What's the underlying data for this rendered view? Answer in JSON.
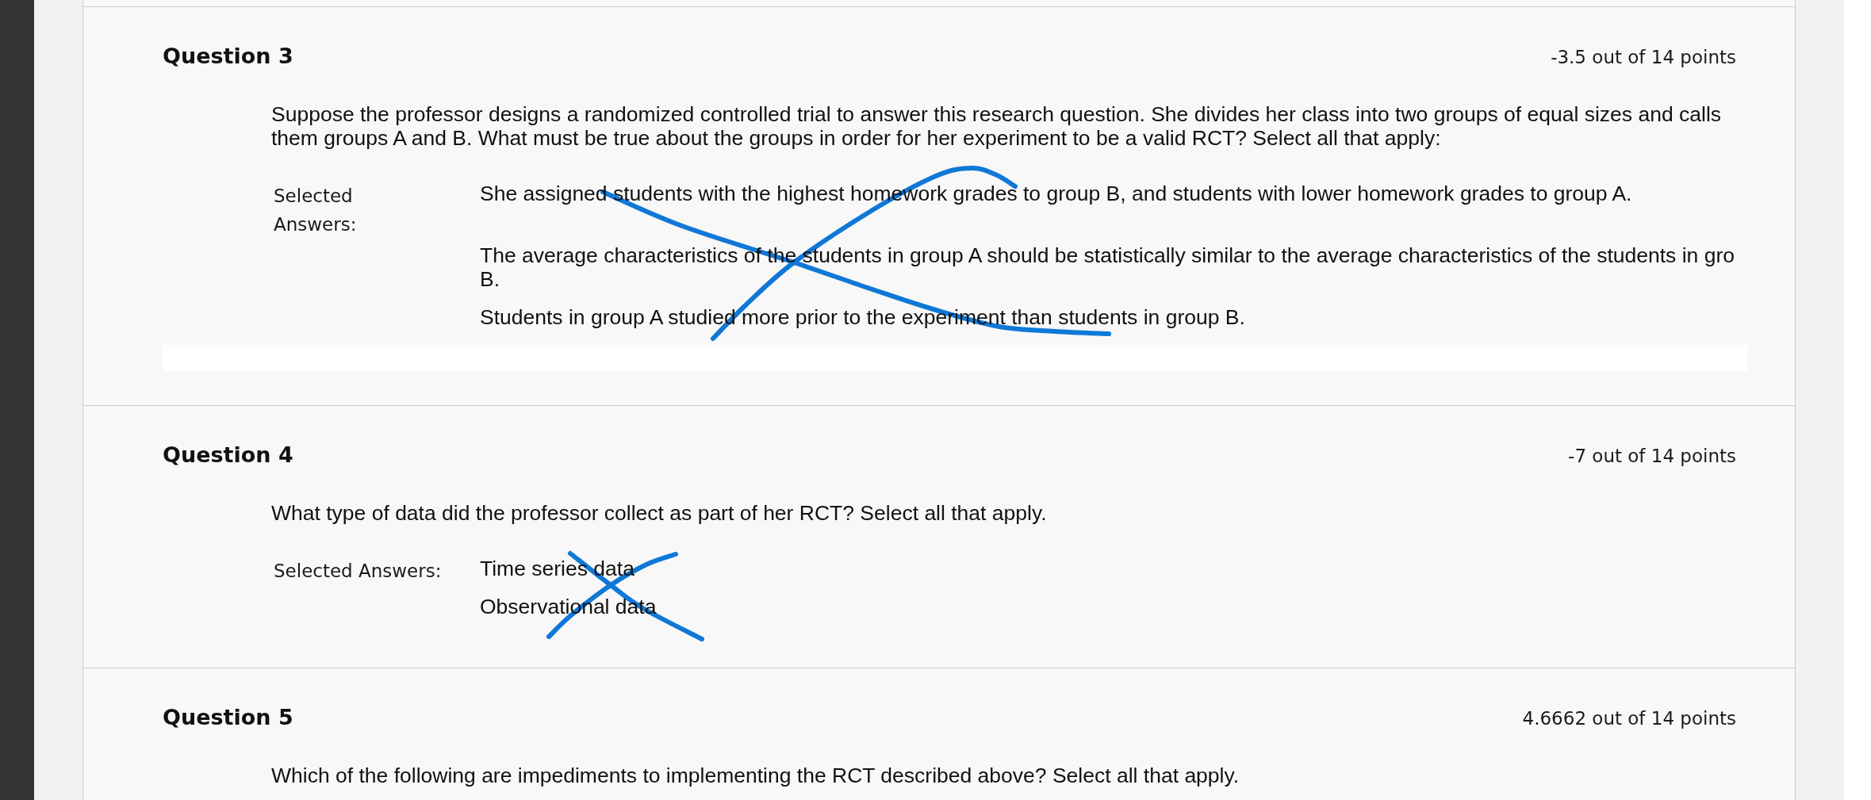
{
  "questions": [
    {
      "title": "Question 3",
      "points": "-3.5 out of 14 points",
      "text": "Suppose the professor designs a randomized controlled trial to answer this research question. She divides her class into two groups of equal sizes and calls them groups A and B. What must be true about the groups in order for her experiment to be a valid RCT? Select all that apply:",
      "answers_label": "Selected Answers:",
      "answers": [
        {
          "lines": [
            "She assigned students with the highest homework grades to group B, and students with lower homework grades to group A."
          ]
        },
        {
          "lines": [
            "The average characteristics of the students in group A should be statistically similar to the average characteristics of the students in gro",
            "B."
          ]
        },
        {
          "lines": [
            "Students in group A studied more prior to the experiment than students in group B."
          ]
        }
      ],
      "crossed_out": true,
      "feedback_box": true
    },
    {
      "title": "Question 4",
      "points": "-7 out of 14 points",
      "text": "What type of data did the professor collect as part of her RCT? Select all that apply.",
      "answers_label": "Selected Answers:",
      "answers": [
        {
          "lines": [
            "Time series data"
          ]
        },
        {
          "lines": [
            "Observational data"
          ]
        }
      ],
      "crossed_out": true,
      "feedback_box": false
    },
    {
      "title": "Question 5",
      "points": "4.6662 out of 14 points",
      "text": "Which of the following are impediments to implementing the RCT described above? Select all that apply.",
      "feedback_box": false
    }
  ]
}
